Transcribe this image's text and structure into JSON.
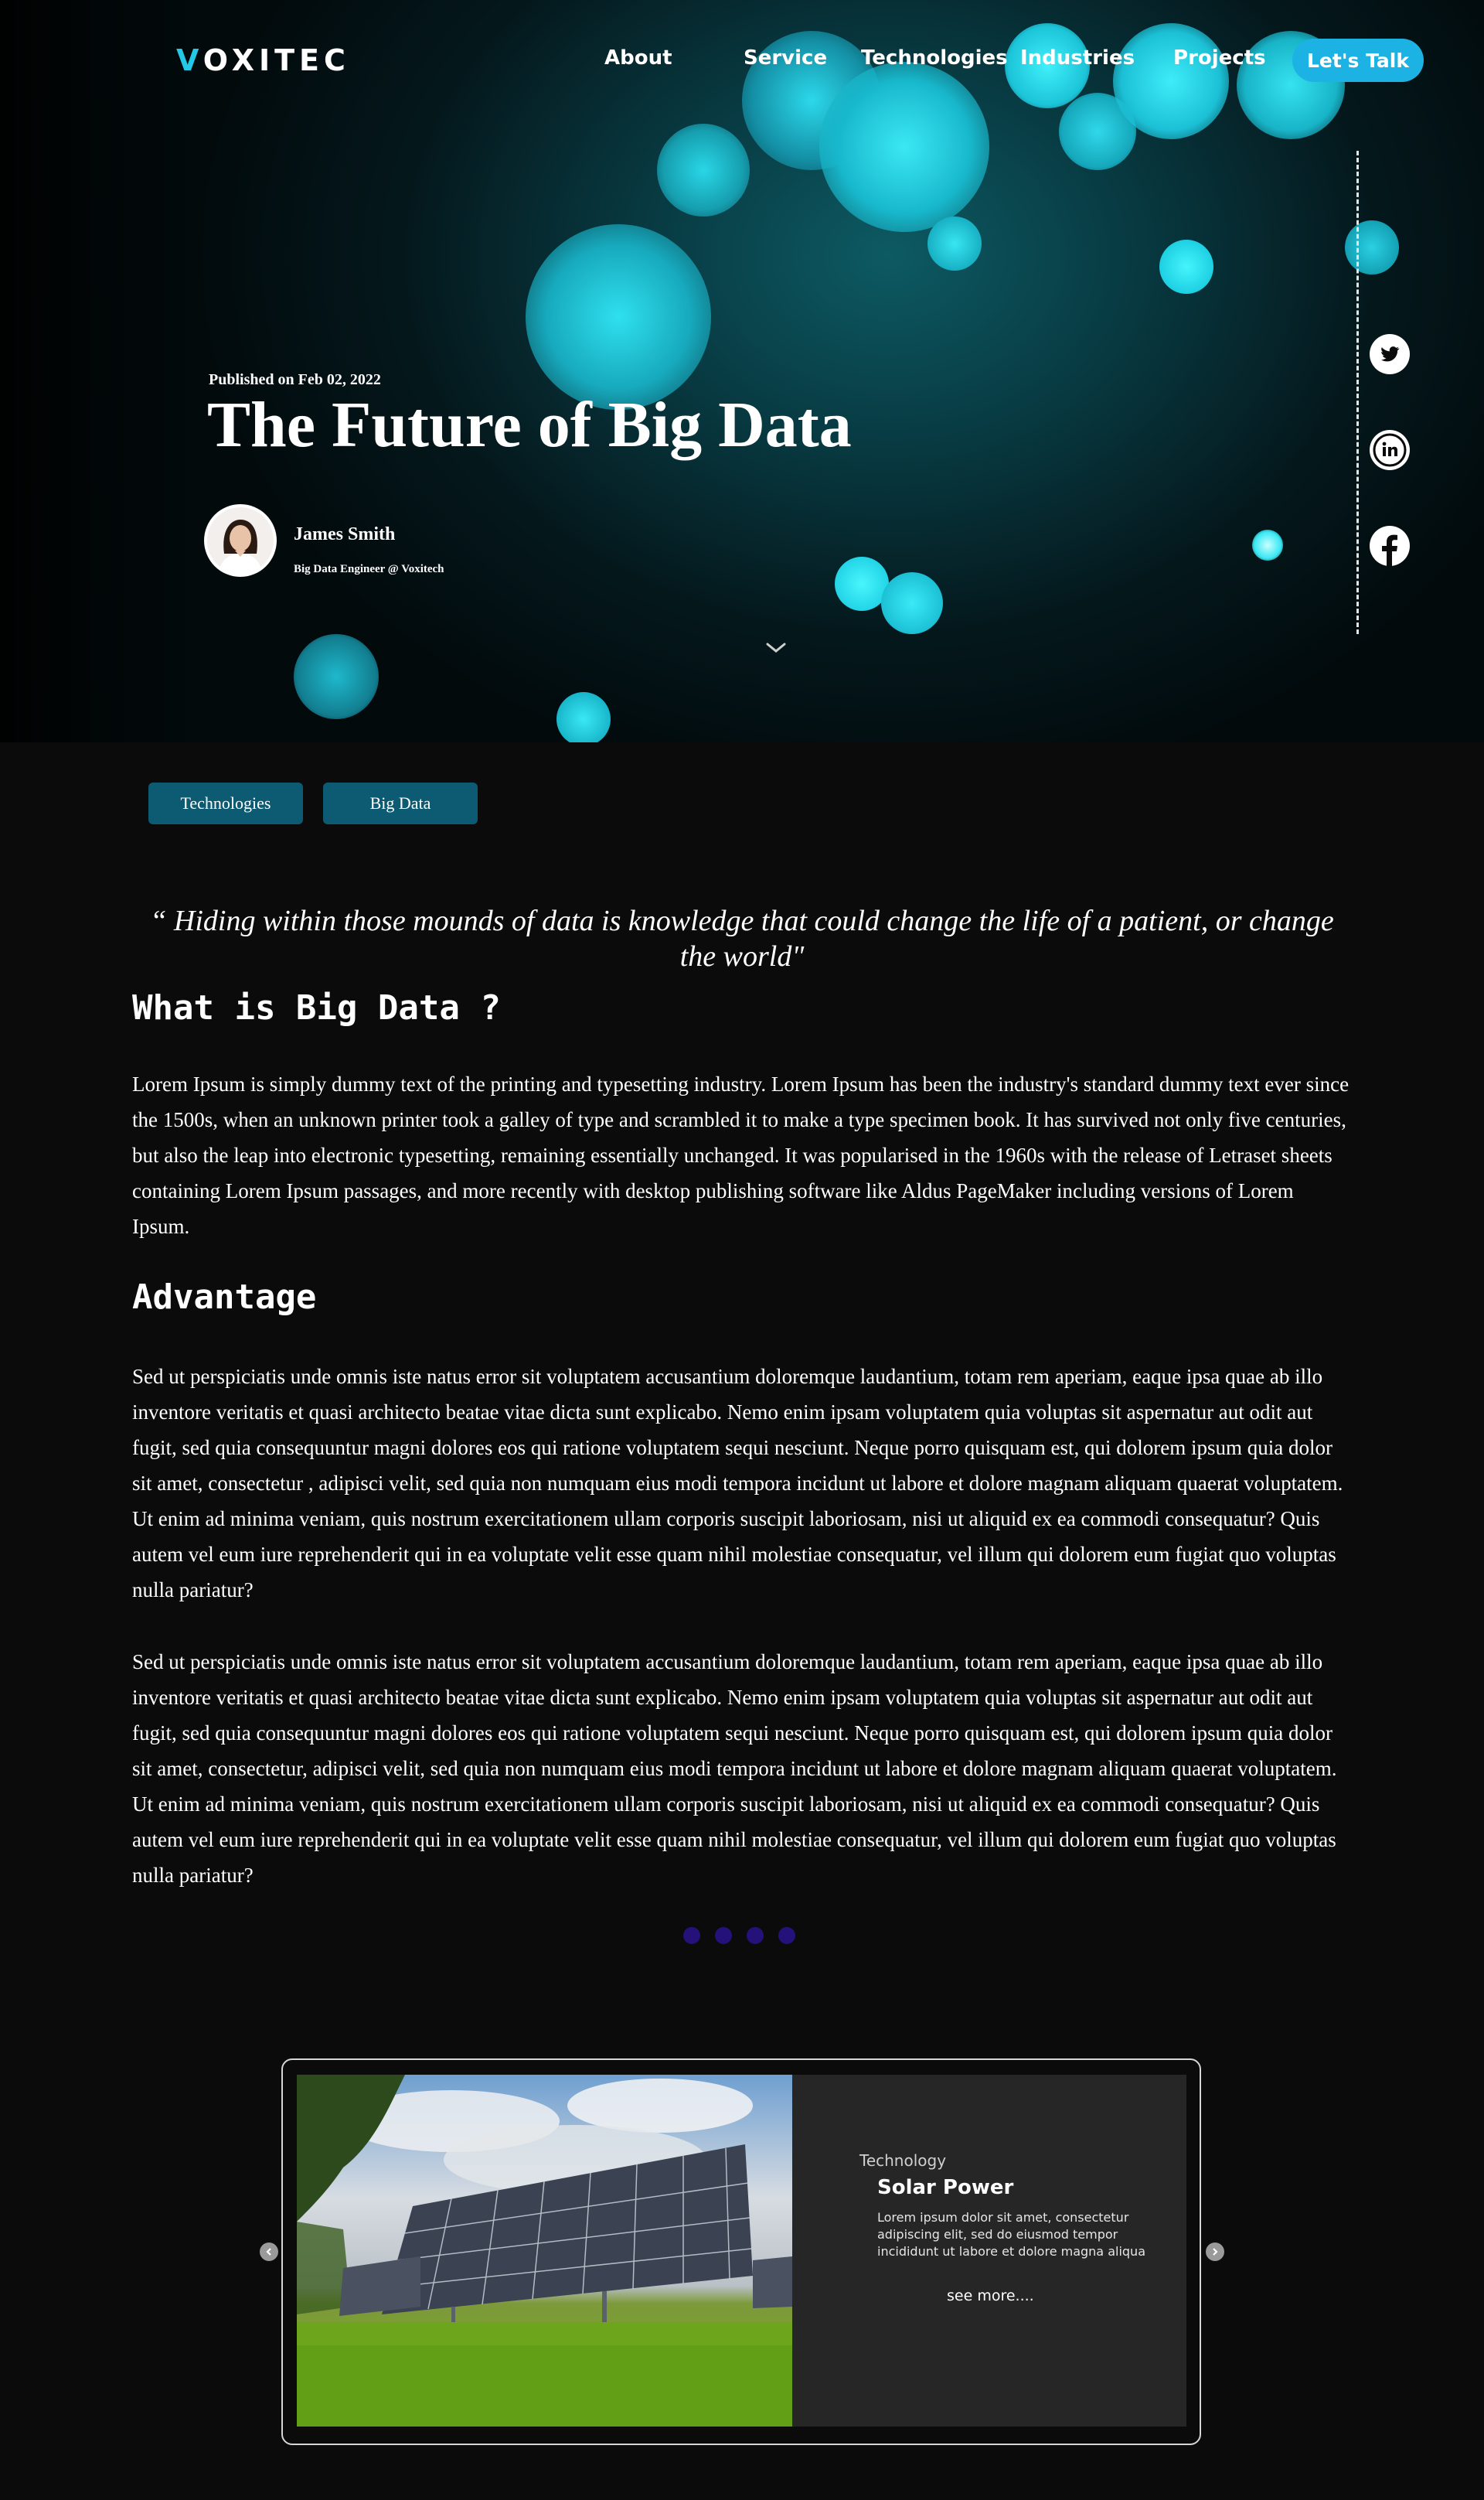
{
  "nav": {
    "logo_prefix": "V",
    "logo_rest": "OXITEC",
    "links": [
      "About",
      "Service",
      "Technologies",
      "Industries",
      "Projects"
    ],
    "cta": "Let's Talk"
  },
  "hero": {
    "published": "Published on Feb 02, 2022",
    "title": "The Future of Big Data",
    "author_name": "James Smith",
    "author_role": "Big Data Engineer @ Voxitech"
  },
  "social": [
    "twitter-icon",
    "linkedin-icon",
    "facebook-icon"
  ],
  "tags": [
    "Technologies",
    "Big Data"
  ],
  "article": {
    "quote": "“ Hiding within those mounds of data is knowledge that could change the life of a patient, or change the world\"",
    "heading1": "What is Big Data ?",
    "para1": "Lorem Ipsum is simply dummy text of the printing and typesetting industry. Lorem Ipsum has been the industry's standard dummy text ever since the 1500s, when an unknown printer took a galley of type and scrambled it to make a type specimen book. It has survived not only five centuries, but also the leap into electronic typesetting, remaining essentially unchanged. It was popularised in the 1960s with the release of Letraset sheets containing Lorem Ipsum passages, and more recently with desktop publishing software like Aldus PageMaker including versions of Lorem Ipsum.",
    "heading2": "Advantage",
    "para2": "Sed ut perspiciatis unde omnis iste natus error sit voluptatem accusantium doloremque laudantium, totam rem aperiam, eaque ipsa quae ab illo inventore veritatis et quasi architecto beatae vitae dicta sunt explicabo. Nemo enim ipsam voluptatem quia voluptas sit aspernatur aut odit aut fugit, sed quia consequuntur magni dolores eos qui ratione voluptatem sequi nesciunt. Neque porro quisquam est, qui dolorem ipsum quia dolor sit amet, consectetur , adipisci velit, sed quia non numquam eius modi tempora incidunt ut labore et dolore magnam aliquam quaerat voluptatem. Ut enim ad minima veniam, quis nostrum exercitationem ullam corporis suscipit laboriosam, nisi ut aliquid ex ea commodi consequatur? Quis autem vel eum iure reprehenderit qui in ea voluptate velit esse quam nihil molestiae consequatur, vel illum qui dolorem eum fugiat quo voluptas nulla pariatur?",
    "para3": "Sed ut perspiciatis unde omnis iste natus error sit voluptatem accusantium doloremque laudantium, totam rem aperiam, eaque ipsa quae ab illo inventore veritatis et quasi architecto beatae vitae dicta sunt explicabo. Nemo enim ipsam voluptatem quia voluptas sit aspernatur aut odit aut fugit, sed quia consequuntur magni dolores eos qui ratione voluptatem sequi nesciunt. Neque porro quisquam est, qui dolorem ipsum quia dolor sit amet, consectetur, adipisci velit, sed quia non numquam eius modi tempora incidunt ut labore et dolore magnam aliquam quaerat voluptatem. Ut enim ad minima veniam, quis nostrum exercitationem ullam corporis suscipit laboriosam, nisi ut aliquid ex ea commodi consequatur? Quis autem vel eum iure reprehenderit qui in ea voluptate velit esse quam nihil molestiae consequatur, vel illum qui dolorem eum fugiat quo voluptas nulla pariatur?"
  },
  "carousel": {
    "category": "Technology",
    "title": "Solar Power",
    "description": "Lorem ipsum dolor sit amet, consectetur adipiscing elit, sed do eiusmod tempor incididunt ut labore et dolore magna aliqua",
    "more": "see more...."
  },
  "colors": {
    "accent": "#1cb2e3",
    "tag_bg": "#0d5a73",
    "dot": "#24127a",
    "page_bg": "#0b0b0b"
  }
}
